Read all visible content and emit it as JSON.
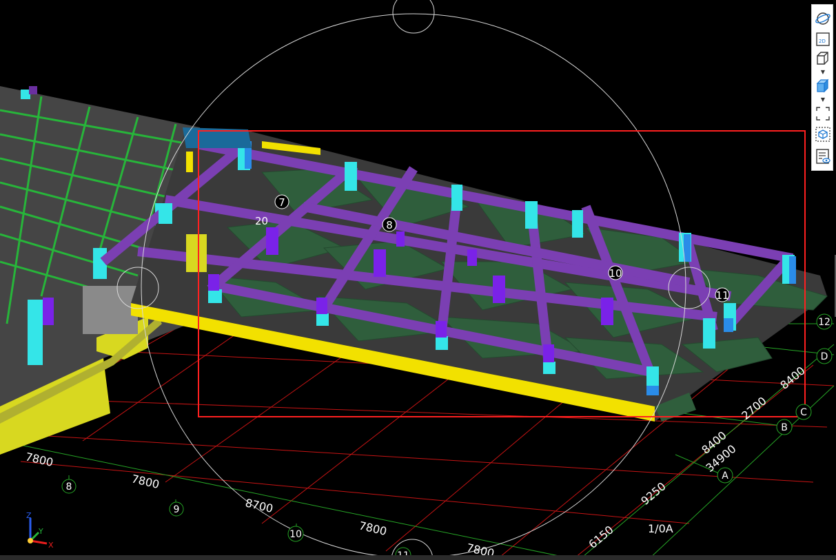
{
  "toolbar": {
    "buttons": [
      {
        "name": "orbit-button",
        "icon": "orbit-icon",
        "label": ""
      },
      {
        "name": "view-2d-button",
        "icon": "view-2d-icon",
        "label": "2D"
      },
      {
        "name": "view-3d-wireframe-button",
        "icon": "cube-wireframe-icon",
        "label": ""
      },
      {
        "name": "view-3d-shaded-button",
        "icon": "cube-shaded-icon",
        "label": ""
      },
      {
        "name": "fit-view-button",
        "icon": "fit-frame-icon",
        "label": ""
      },
      {
        "name": "selection-box-button",
        "icon": "box-select-icon",
        "label": ""
      },
      {
        "name": "layer-visibility-button",
        "icon": "layer-list-icon",
        "label": ""
      }
    ]
  },
  "dimensions": {
    "bottom": [
      "7800",
      "7800",
      "8700",
      "7800",
      "7800"
    ],
    "right": [
      "8400",
      "2700",
      "8400",
      "34900",
      "9250",
      "6150"
    ]
  },
  "axis_labels": {
    "bottom": [
      "8",
      "9",
      "10",
      "11"
    ],
    "right": [
      "12",
      "D",
      "C",
      "B",
      "A",
      "1/0A"
    ],
    "model": [
      "7",
      "8",
      "10",
      "11",
      "20"
    ]
  },
  "coord_axes": {
    "x": "X",
    "y": "Y",
    "z": "Z"
  },
  "colors": {
    "background": "#000000",
    "selection": "#ff2020",
    "beam": "#7b3fb3",
    "column": "#34e5e8",
    "slab": "#3a3a3a",
    "foundation": "#2f5e3c",
    "edge_beam": "#f2e100",
    "grid_red": "#c81414",
    "grid_green": "#26a626"
  }
}
